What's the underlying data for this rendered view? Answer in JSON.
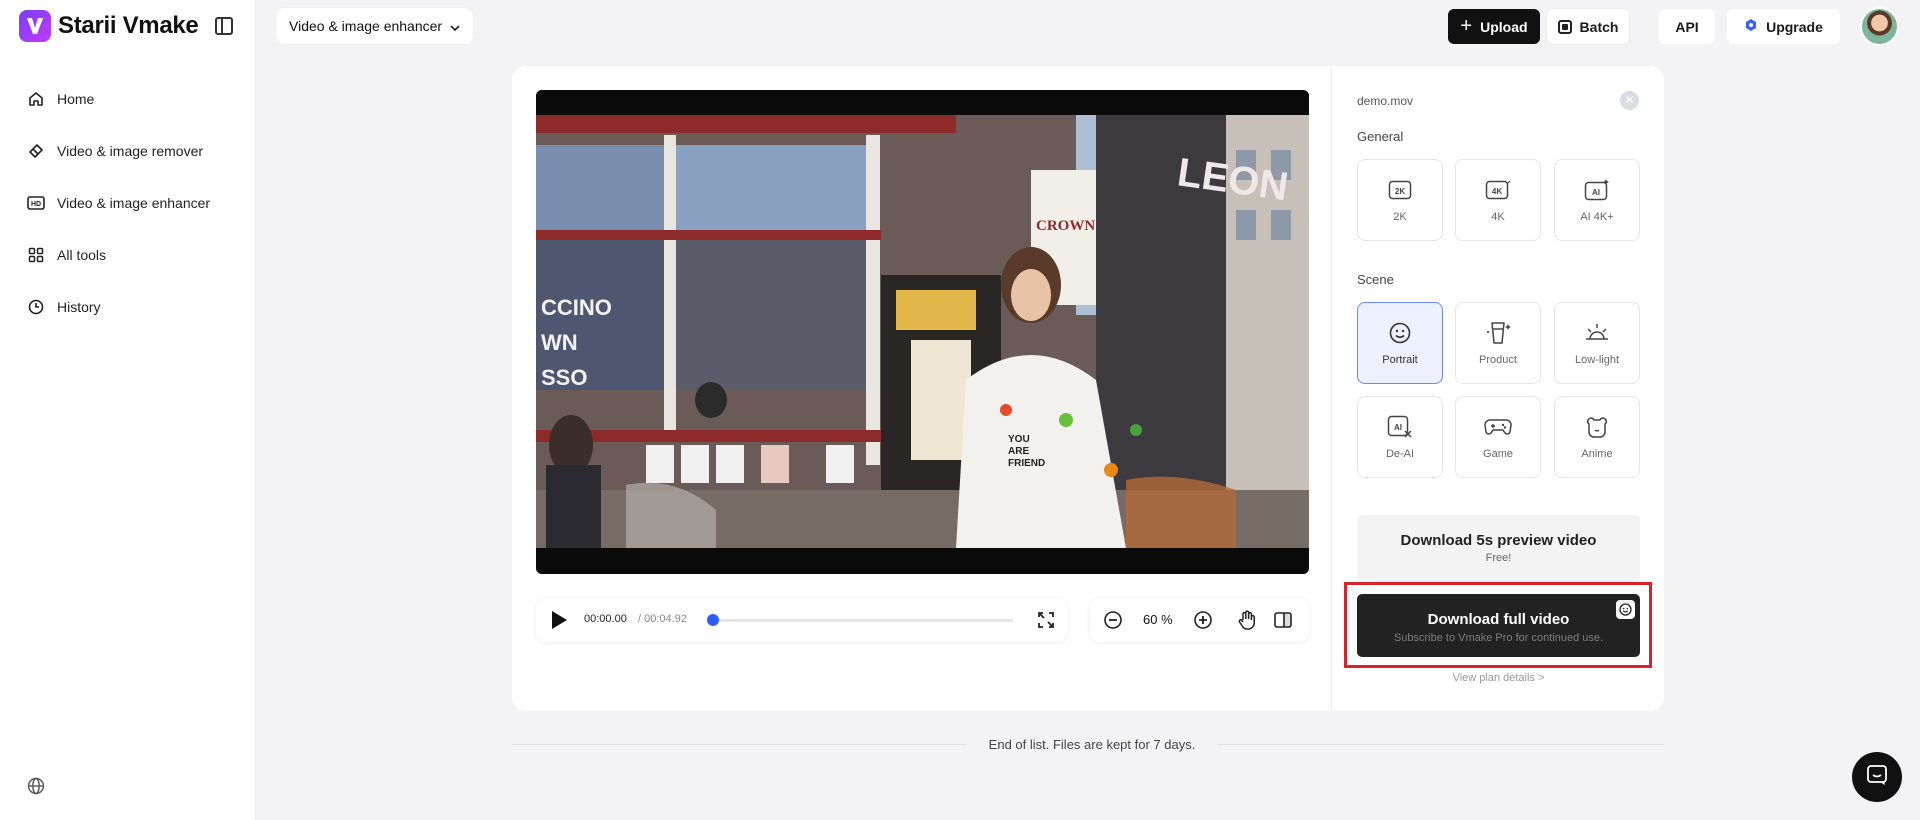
{
  "app": {
    "name": "Starii Vmake"
  },
  "sidebar": {
    "items": [
      {
        "label": "Home",
        "icon": "home-icon"
      },
      {
        "label": "Video & image remover",
        "icon": "eraser-icon"
      },
      {
        "label": "Video & image enhancer",
        "icon": "hd-icon"
      },
      {
        "label": "All tools",
        "icon": "grid-icon"
      },
      {
        "label": "History",
        "icon": "clock-icon"
      }
    ]
  },
  "header": {
    "tool_select": "Video & image enhancer",
    "upload_label": "Upload",
    "batch_label": "Batch",
    "api_label": "API",
    "upgrade_label": "Upgrade"
  },
  "video": {
    "sign_crown": "CROWN",
    "sign_leon": "LEON",
    "window_text_1": "CCINO",
    "window_text_2": "WN",
    "window_text_3": "SSO"
  },
  "player": {
    "current_time": "00:00.00",
    "total_time": "/ 00:04.92",
    "progress": 0.0
  },
  "zoom": {
    "value": "60 %"
  },
  "panel": {
    "file_name": "demo.mov",
    "general_label": "General",
    "general_options": [
      "2K",
      "4K",
      "AI 4K+"
    ],
    "scene_label": "Scene",
    "scene_options": [
      "Portrait",
      "Product",
      "Low-light",
      "De-AI",
      "Game",
      "Anime"
    ],
    "selected_scene": "Portrait",
    "preview_title": "Download 5s preview video",
    "preview_sub": "Free!",
    "full_title": "Download full video",
    "full_sub": "Subscribe to Vmake Pro for continued use.",
    "plan_link": "View plan details >"
  },
  "footer": {
    "end_text": "End of list. Files are kept for 7 days."
  },
  "colors": {
    "accent": "#2f5cff",
    "highlight": "#d6232e",
    "brand": "#7a3cff"
  }
}
